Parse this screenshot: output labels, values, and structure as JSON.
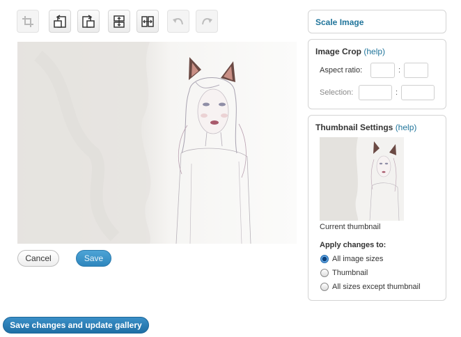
{
  "toolbar": {
    "buttons": [
      {
        "icon": "crop-icon",
        "enabled": false
      },
      {
        "icon": "rotate-counterclockwise-icon",
        "enabled": true
      },
      {
        "icon": "rotate-clockwise-icon",
        "enabled": true
      },
      {
        "icon": "flip-vertical-icon",
        "enabled": true
      },
      {
        "icon": "flip-horizontal-icon",
        "enabled": true
      },
      {
        "icon": "undo-icon",
        "enabled": false
      },
      {
        "icon": "redo-icon",
        "enabled": false
      }
    ]
  },
  "actions": {
    "cancel_label": "Cancel",
    "save_label": "Save",
    "save_gallery_label": "Save changes and update gallery"
  },
  "scale_panel": {
    "title": "Scale Image"
  },
  "crop_panel": {
    "title": "Image Crop",
    "help": "(help)",
    "aspect_label": "Aspect ratio:",
    "aspect_w": "",
    "aspect_h": "",
    "selection_label": "Selection:",
    "selection_w": "",
    "selection_h": "",
    "separator": ":"
  },
  "thumb_panel": {
    "title": "Thumbnail Settings",
    "help": "(help)",
    "caption": "Current thumbnail",
    "apply_label": "Apply changes to:",
    "options": [
      {
        "label": "All image sizes",
        "checked": true
      },
      {
        "label": "Thumbnail",
        "checked": false
      },
      {
        "label": "All sizes except thumbnail",
        "checked": false
      }
    ]
  },
  "colors": {
    "accent": "#21759b",
    "primary_button": "#2e86bd",
    "gallery_button": "#1f6fa5"
  }
}
